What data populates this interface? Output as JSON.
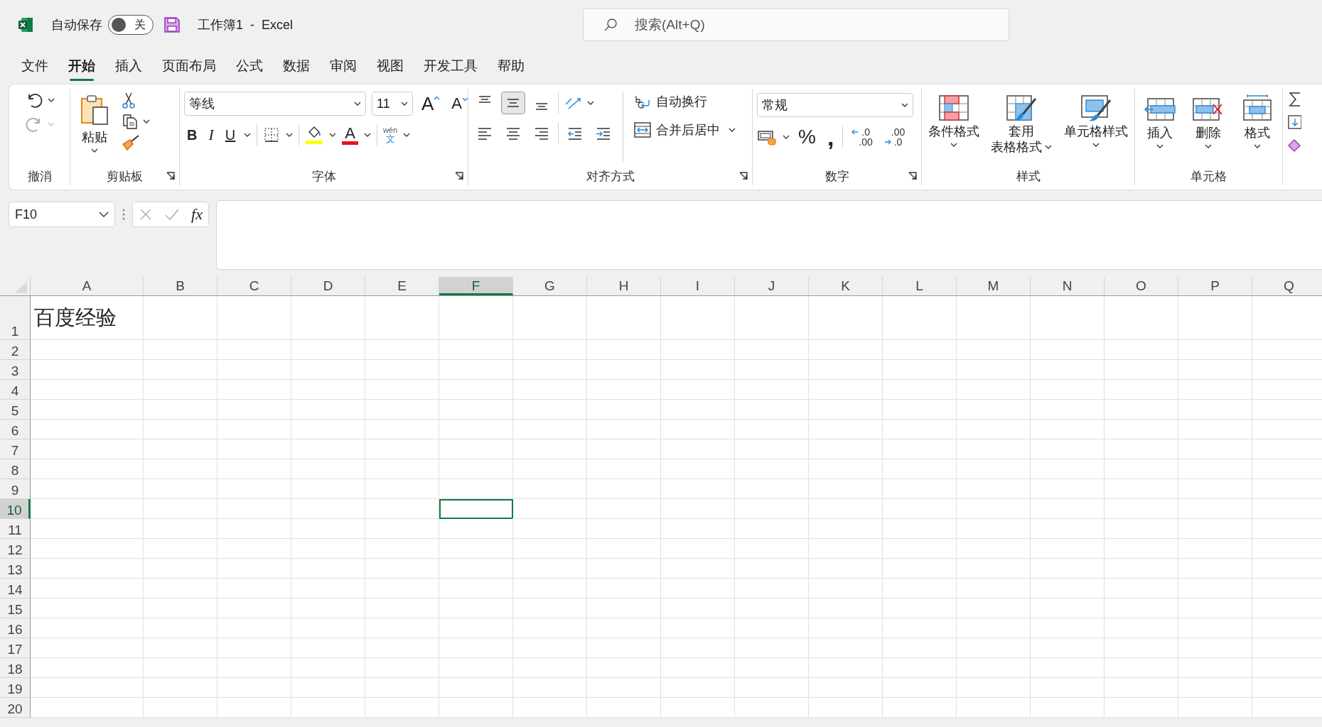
{
  "title_bar": {
    "autosave_label": "自动保存",
    "autosave": {
      "on": false,
      "label": "关"
    },
    "title": "工作簿1  -  Excel",
    "search": {
      "placeholder": "搜索(Alt+Q)"
    }
  },
  "tabs": [
    {
      "label": "文件",
      "selected": false
    },
    {
      "label": "开始",
      "selected": true
    },
    {
      "label": "插入",
      "selected": false
    },
    {
      "label": "页面布局",
      "selected": false
    },
    {
      "label": "公式",
      "selected": false
    },
    {
      "label": "数据",
      "selected": false
    },
    {
      "label": "审阅",
      "selected": false
    },
    {
      "label": "视图",
      "selected": false
    },
    {
      "label": "开发工具",
      "selected": false
    },
    {
      "label": "帮助",
      "selected": false
    }
  ],
  "ribbon": {
    "undo": {
      "label": "撤消"
    },
    "clipboard": {
      "label": "剪贴板",
      "paste": "粘贴"
    },
    "font": {
      "label": "字体",
      "family": "等线",
      "size": "11",
      "grow": "A",
      "shrink": "A",
      "bold": "B",
      "italic": "I",
      "underline": "U",
      "font_color": "A",
      "phonetic_top": "wén",
      "phonetic_bottom": "文"
    },
    "alignment": {
      "label": "对齐方式",
      "vertical": [
        {
          "kind": "top",
          "selected": false
        },
        {
          "kind": "middle",
          "selected": true
        },
        {
          "kind": "bottom",
          "selected": false
        }
      ],
      "wrap": "自动换行",
      "merge": "合并后居中"
    },
    "number": {
      "label": "数字",
      "format": "常规",
      "percent": "%",
      "comma": ",",
      "decimals": [
        {
          "kind": "increase",
          "top": ".0",
          "bottom": ".00"
        },
        {
          "kind": "decrease",
          "top": ".00",
          "bottom": ".0"
        }
      ]
    },
    "styles": {
      "label": "样式",
      "buttons": [
        {
          "kind": "conditional",
          "lines": [
            "条件格式"
          ]
        },
        {
          "kind": "table",
          "lines": [
            "套用",
            "表格格式"
          ]
        },
        {
          "kind": "cell",
          "lines": [
            "单元格样式"
          ]
        }
      ]
    },
    "cells": {
      "label": "单元格",
      "buttons": [
        {
          "kind": "insert",
          "label": "插入"
        },
        {
          "kind": "delete",
          "label": "删除"
        },
        {
          "kind": "format",
          "label": "格式"
        }
      ]
    }
  },
  "formula_bar": {
    "name_box": "F10",
    "fx": "fx"
  },
  "sheet": {
    "columns": [
      {
        "label": "A",
        "selected": false
      },
      {
        "label": "B",
        "selected": false
      },
      {
        "label": "C",
        "selected": false
      },
      {
        "label": "D",
        "selected": false
      },
      {
        "label": "E",
        "selected": false
      },
      {
        "label": "F",
        "selected": true
      },
      {
        "label": "G",
        "selected": false
      },
      {
        "label": "H",
        "selected": false
      },
      {
        "label": "I",
        "selected": false
      },
      {
        "label": "J",
        "selected": false
      },
      {
        "label": "K",
        "selected": false
      },
      {
        "label": "L",
        "selected": false
      },
      {
        "label": "M",
        "selected": false
      },
      {
        "label": "N",
        "selected": false
      },
      {
        "label": "O",
        "selected": false
      },
      {
        "label": "P",
        "selected": false
      },
      {
        "label": "Q",
        "selected": false
      }
    ],
    "rows": [
      {
        "label": "1",
        "selected": false,
        "cell_a": "百度经验"
      },
      {
        "label": "2",
        "selected": false
      },
      {
        "label": "3",
        "selected": false
      },
      {
        "label": "4",
        "selected": false
      },
      {
        "label": "5",
        "selected": false
      },
      {
        "label": "6",
        "selected": false
      },
      {
        "label": "7",
        "selected": false
      },
      {
        "label": "8",
        "selected": false
      },
      {
        "label": "9",
        "selected": false
      },
      {
        "label": "10",
        "selected": true
      },
      {
        "label": "11",
        "selected": false
      },
      {
        "label": "12",
        "selected": false
      },
      {
        "label": "13",
        "selected": false
      },
      {
        "label": "14",
        "selected": false
      },
      {
        "label": "15",
        "selected": false
      },
      {
        "label": "16",
        "selected": false
      },
      {
        "label": "17",
        "selected": false
      },
      {
        "label": "18",
        "selected": false
      },
      {
        "label": "19",
        "selected": false
      },
      {
        "label": "20",
        "selected": false
      }
    ]
  }
}
